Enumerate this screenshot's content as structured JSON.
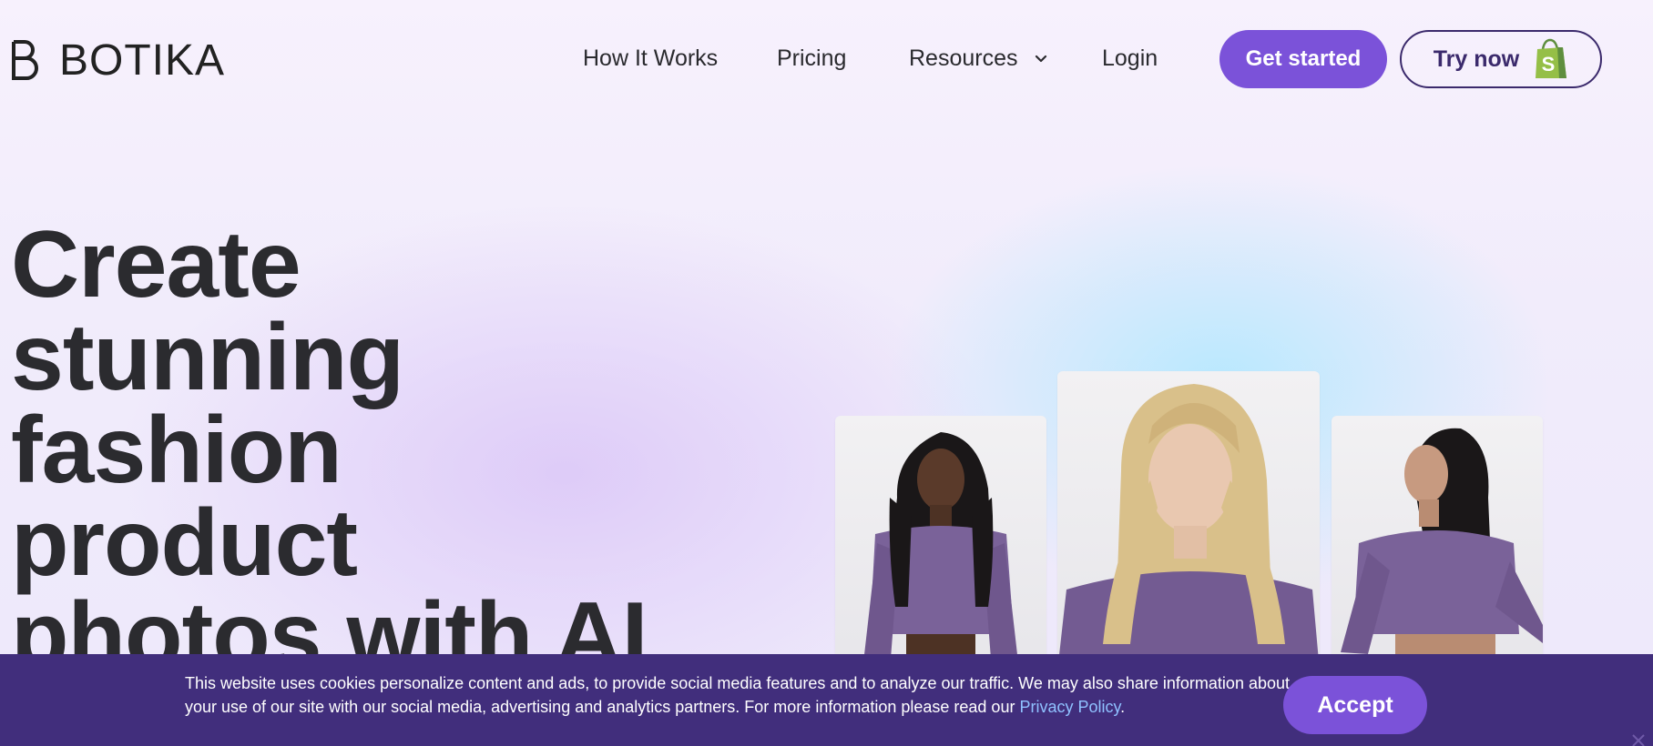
{
  "brand": {
    "name": "BOTIKA",
    "logo_icon": "botika-logo-icon"
  },
  "nav": {
    "items": [
      {
        "label": "How It Works"
      },
      {
        "label": "Pricing"
      },
      {
        "label": "Resources",
        "icon": "chevron-down-icon"
      },
      {
        "label": "Login"
      }
    ],
    "get_started": "Get started",
    "try_now": "Try now",
    "try_now_icon": "shopify-bag-icon"
  },
  "hero": {
    "title_lines": [
      "Create",
      "stunning",
      "fashion",
      "product",
      "photos with AI"
    ]
  },
  "photos": [
    {
      "name": "model-photo-1",
      "shirt_color": "#7a6299"
    },
    {
      "name": "model-photo-2",
      "shirt_color": "#735b92"
    },
    {
      "name": "model-photo-3",
      "shirt_color": "#7a6299"
    }
  ],
  "cookie_banner": {
    "text": "This website uses cookies personalize content and ads, to provide social media features and to analyze our traffic. We may also share information about your use of our site with our social media, advertising and analytics partners. For more information please read our ",
    "link": "Privacy Policy",
    "suffix": ".",
    "accept": "Accept",
    "close_icon": "close-icon"
  },
  "colors": {
    "accent": "#7b52d9",
    "dark_purple": "#412e7c",
    "link": "#8fc1ff"
  }
}
